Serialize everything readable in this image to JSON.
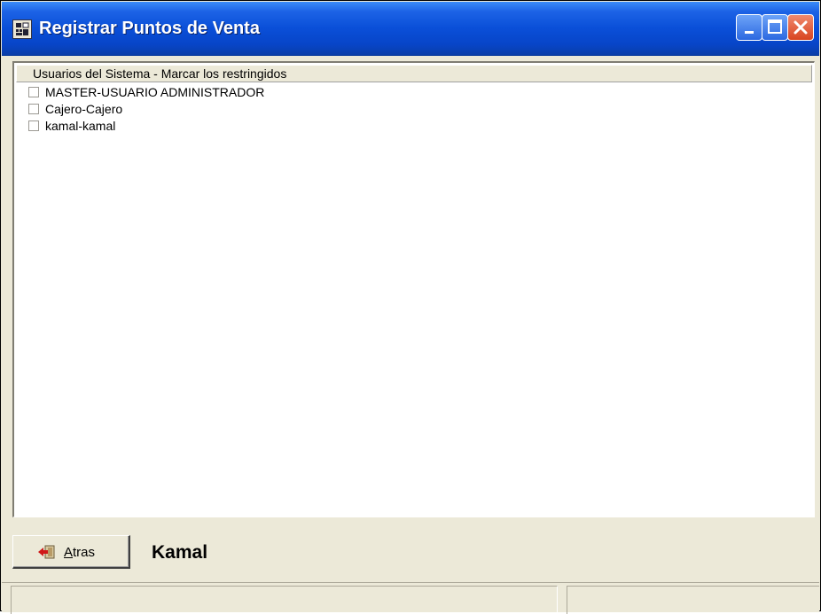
{
  "window": {
    "title": "Registrar Puntos de Venta",
    "title_icon": "app-calculator-icon",
    "buttons": [
      "minimize-icon",
      "maximize-icon",
      "close-icon"
    ]
  },
  "list": {
    "header": "Usuarios del Sistema - Marcar los restringidos",
    "items": [
      {
        "label": "MASTER-USUARIO ADMINISTRADOR",
        "checked": false
      },
      {
        "label": "Cajero-Cajero",
        "checked": false
      },
      {
        "label": "kamal-kamal",
        "checked": false
      }
    ]
  },
  "footer": {
    "back_button": {
      "label": "Atras",
      "accelerator": "A",
      "rest": "tras",
      "icon": "back-arrow-icon"
    },
    "current_user": "Kamal"
  },
  "statusbar": {
    "panel1": "",
    "panel2": ""
  },
  "colors": {
    "titlebar": "#0a4fd8",
    "window_bg": "#ece9d8",
    "close_button": "#d84420"
  }
}
